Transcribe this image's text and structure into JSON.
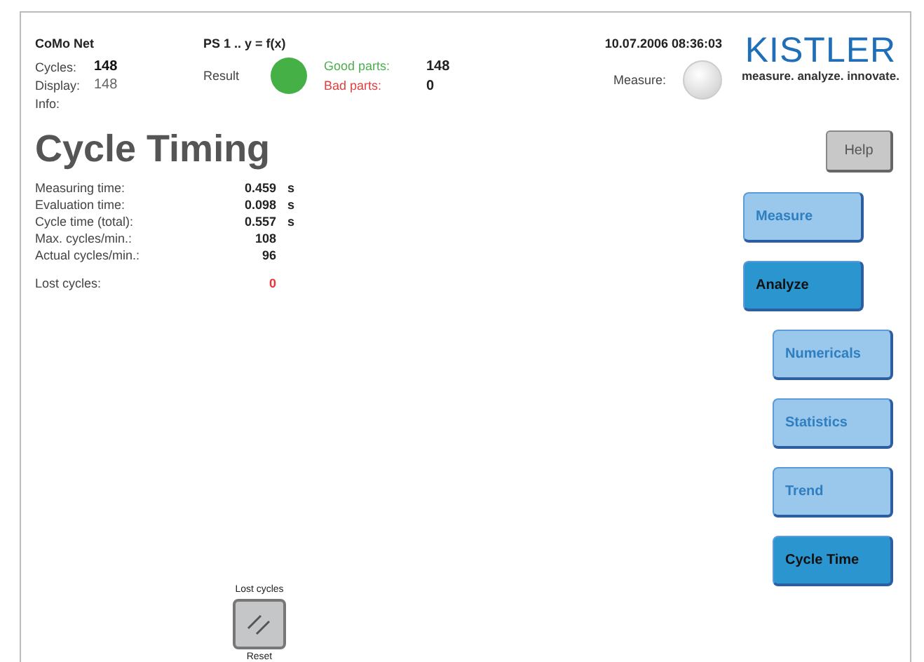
{
  "header": {
    "app": "CoMo Net",
    "counters": [
      {
        "label": "Cycles:",
        "value": "148",
        "bold": true
      },
      {
        "label": "Display:",
        "value": "148",
        "bold": false
      },
      {
        "label": "Info:"
      }
    ],
    "program": "PS 1 .. y = f(x)",
    "result": {
      "label": "Result",
      "ok": true
    },
    "parts": [
      {
        "label": "Good parts:",
        "value": "148",
        "kind": "good"
      },
      {
        "label": "Bad parts:",
        "value": "0",
        "kind": "bad"
      }
    ],
    "datetime": "10.07.2006  08:36:03",
    "measure": {
      "label": "Measure:",
      "on": false
    },
    "logo": {
      "name": "KISTLER",
      "slogan": "measure. analyze. innovate."
    }
  },
  "title": "Cycle Timing",
  "metrics": [
    {
      "label": "Measuring time:",
      "value": "0.459",
      "unit": "s",
      "alert": false
    },
    {
      "label": "Evaluation time:",
      "value": "0.098",
      "unit": "s",
      "alert": false
    },
    {
      "label": "Cycle time (total):",
      "value": "0.557",
      "unit": "s",
      "alert": false
    },
    {
      "label": "Max. cycles/min.:",
      "value": "108",
      "alert": false
    },
    {
      "label": "Actual cycles/min.:",
      "value": "96",
      "alert": false
    },
    {
      "label": "Lost cycles:",
      "value": "0",
      "alert": true
    }
  ],
  "reset": {
    "caption": "Lost cycles",
    "label": "Reset"
  },
  "help": "Help",
  "nav": [
    {
      "label": "Measure",
      "selected": false
    },
    {
      "label": "Analyze",
      "selected": true,
      "children": [
        {
          "label": "Numericals",
          "selected": false
        },
        {
          "label": "Statistics",
          "selected": false
        },
        {
          "label": "Trend",
          "selected": false
        },
        {
          "label": "Cycle Time",
          "selected": true
        }
      ]
    }
  ]
}
